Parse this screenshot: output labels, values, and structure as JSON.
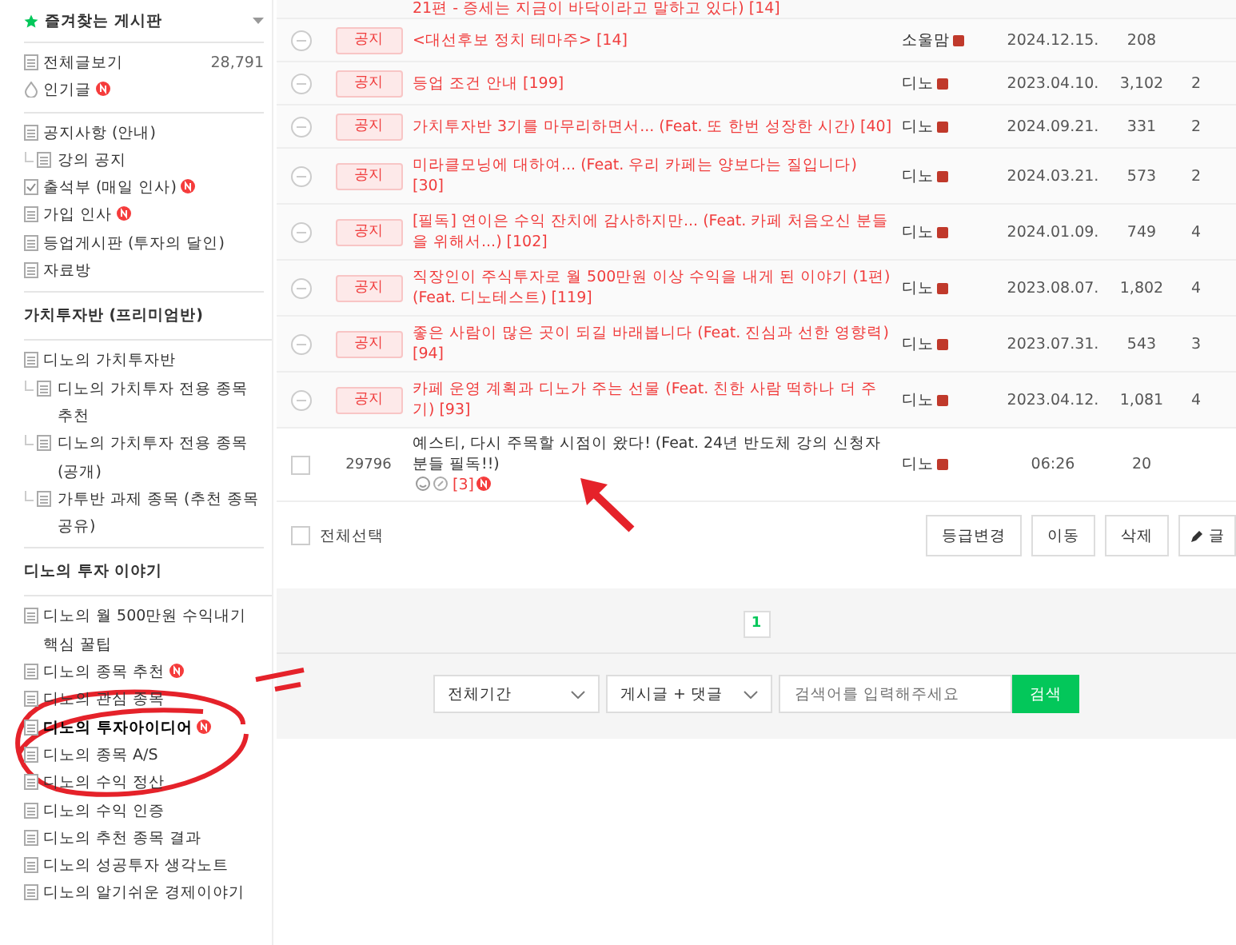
{
  "sidebar": {
    "favorites": {
      "title": "즐겨찾는 게시판",
      "expanded": true
    },
    "groups": [
      {
        "items": [
          {
            "kind": "board",
            "label": "전체글보기",
            "count": "28,791",
            "new": false,
            "selected": false
          },
          {
            "kind": "popular",
            "label": "인기글",
            "new": true,
            "selected": false
          }
        ]
      },
      {
        "items": [
          {
            "kind": "board",
            "label": "공지사항 (안내)",
            "new": false,
            "selected": false,
            "children": [
              {
                "kind": "board",
                "label": "강의 공지",
                "new": false,
                "selected": false
              }
            ]
          },
          {
            "kind": "attendance",
            "label": "출석부 (매일 인사)",
            "new": true,
            "selected": false
          },
          {
            "kind": "board",
            "label": "가입 인사",
            "new": true,
            "selected": false
          },
          {
            "kind": "board",
            "label": "등업게시판 (투자의 달인)",
            "new": false,
            "selected": false
          },
          {
            "kind": "board",
            "label": "자료방",
            "new": false,
            "selected": false
          }
        ]
      },
      {
        "title": "가치투자반 (프리미엄반)",
        "items": [
          {
            "kind": "board",
            "label": "디노의 가치투자반",
            "new": false,
            "selected": false,
            "children": [
              {
                "kind": "board",
                "label": "디노의 가치투자 전용 종목추천",
                "new": false,
                "selected": false
              },
              {
                "kind": "board",
                "label": "디노의 가치투자 전용 종목 (공개)",
                "new": false,
                "selected": false
              },
              {
                "kind": "board",
                "label": "가투반 과제 종목 (추천 종목 공유)",
                "new": false,
                "selected": false
              }
            ]
          }
        ]
      },
      {
        "title": "디노의 투자 이야기",
        "items": [
          {
            "kind": "board",
            "label": "디노의 월 500만원 수익내기 핵심 꿀팁",
            "new": false,
            "selected": false
          },
          {
            "kind": "board",
            "label": "디노의 종목 추천",
            "new": true,
            "selected": false
          },
          {
            "kind": "board",
            "label": "디노의 관심 종목",
            "new": false,
            "selected": false
          },
          {
            "kind": "board",
            "label": "디노의 투자아이디어",
            "new": true,
            "selected": true
          },
          {
            "kind": "board",
            "label": "디노의 종목 A/S",
            "new": false,
            "selected": false
          },
          {
            "kind": "board",
            "label": "디노의 수익 정산",
            "new": false,
            "selected": false
          },
          {
            "kind": "board",
            "label": "디노의 수익 인증",
            "new": false,
            "selected": false
          },
          {
            "kind": "board",
            "label": "디노의 추천 종목 결과",
            "new": false,
            "selected": false
          },
          {
            "kind": "board",
            "label": "디노의 성공투자 생각노트",
            "new": false,
            "selected": false
          },
          {
            "kind": "board",
            "label": "디노의 알기쉬운 경제이야기",
            "new": false,
            "selected": false
          }
        ]
      }
    ]
  },
  "table": {
    "rows": [
      {
        "kind": "partial",
        "title": "21편 - 증세는 지금이 바닥이라고 말하고 있다) [14]"
      },
      {
        "kind": "notice",
        "badge": "공지",
        "title": "<대선후보 정치 테마주> [14]",
        "author": "소울맘",
        "date": "2024.12.15.",
        "views": "208"
      },
      {
        "kind": "notice",
        "badge": "공지",
        "title": "등업 조건 안내 [199]",
        "author": "디노",
        "date": "2023.04.10.",
        "views": "3,102",
        "column_5": "2"
      },
      {
        "kind": "notice",
        "badge": "공지",
        "title": "가치투자반 3기를 마무리하면서... (Feat. 또 한번 성장한 시간) [40]",
        "author": "디노",
        "date": "2024.09.21.",
        "views": "331",
        "column_5": "2"
      },
      {
        "kind": "notice",
        "badge": "공지",
        "title": "미라클모닝에 대하여... (Feat. 우리 카페는 양보다는 질입니다) [30]",
        "author": "디노",
        "date": "2024.03.21.",
        "views": "573",
        "column_5": "2"
      },
      {
        "kind": "notice",
        "badge": "공지",
        "title": "[필독] 연이은 수익 잔치에 감사하지만... (Feat. 카페 처음오신 분들을 위해서...) [102]",
        "author": "디노",
        "date": "2024.01.09.",
        "views": "749",
        "column_5": "4"
      },
      {
        "kind": "notice",
        "badge": "공지",
        "title": "직장인이 주식투자로 월 500만원 이상 수익을 내게 된 이야기 (1편) (Feat. 디노테스트) [119]",
        "author": "디노",
        "date": "2023.08.07.",
        "views": "1,802",
        "column_5": "4"
      },
      {
        "kind": "notice",
        "badge": "공지",
        "title": "좋은 사람이 많은 곳이 되길 바래봅니다 (Feat. 진심과 선한 영향력) [94]",
        "author": "디노",
        "date": "2023.07.31.",
        "views": "543",
        "column_5": "3"
      },
      {
        "kind": "notice",
        "badge": "공지",
        "title": "카페 운영 계획과 디노가 주는 선물 (Feat. 친한 사람 떡하나 더 주기) [93]",
        "author": "디노",
        "date": "2023.04.12.",
        "views": "1,081",
        "column_5": "4"
      },
      {
        "kind": "post",
        "number": "29796",
        "checked": false,
        "title": "예스티, 다시 주목할 시점이 왔다! (Feat. 24년 반도체 강의 신청자분들 필독!!)",
        "comments": "[3]",
        "new": true,
        "author": "디노",
        "date": "06:26",
        "views": "20"
      }
    ]
  },
  "actions": {
    "select_all": {
      "label": "전체선택",
      "checked": false
    },
    "buttons": [
      "등급변경",
      "이동",
      "삭제"
    ],
    "write_button": "글"
  },
  "pagination": [
    {
      "label": "1",
      "selected": true
    }
  ],
  "search": {
    "period": "전체기간",
    "scope": "게시글 + 댓글",
    "placeholder": "검색어를 입력해주세요",
    "button": "검색"
  }
}
